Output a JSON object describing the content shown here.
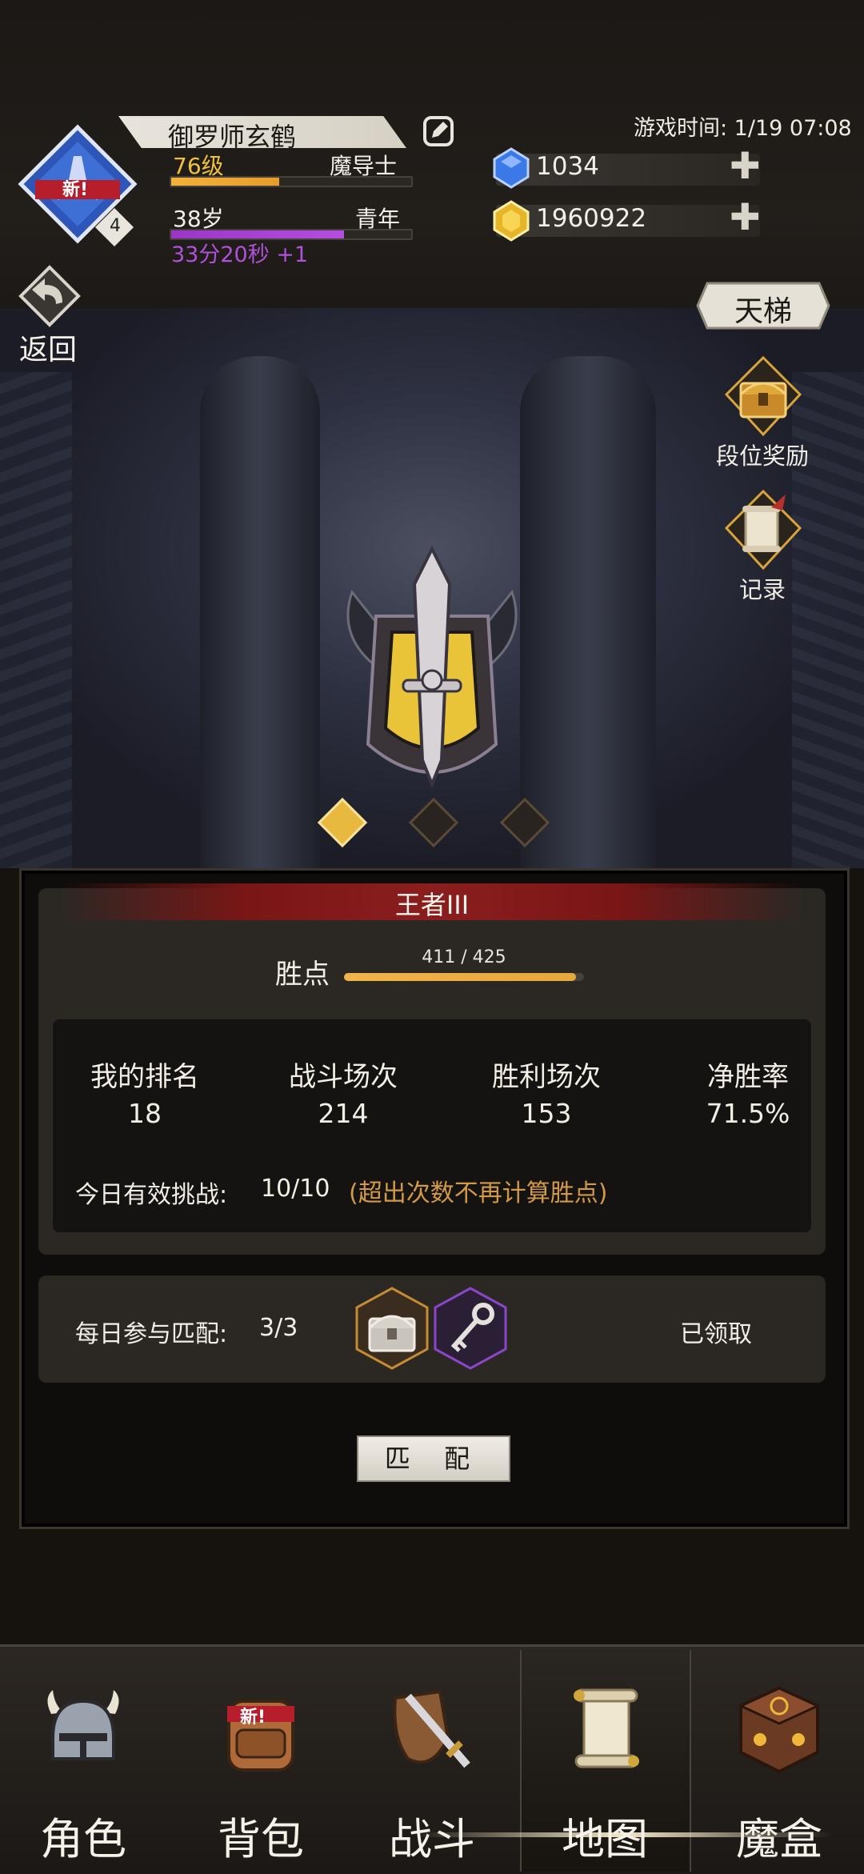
{
  "profile": {
    "name": "御罗师玄鹤",
    "level": "76级",
    "class": "魔导士",
    "age": "38岁",
    "stage": "青年",
    "timer": "33分20秒 +1",
    "avatar_badge": "新!",
    "avatar_count": "4",
    "level_progress": 0.45,
    "age_progress": 0.72
  },
  "game_time": "游戏时间: 1/19 07:08",
  "resources": {
    "gems": "1034",
    "gold": "1960922"
  },
  "nav_top": {
    "back_label": "返回",
    "ladder_label": "天梯"
  },
  "side_buttons": {
    "rank_reward": "段位奖励",
    "record": "记录"
  },
  "rank": {
    "title": "王者III",
    "points_label": "胜点",
    "points_value": "411 / 425",
    "points_progress": 0.967,
    "tier_dots": 3,
    "active_dot": 0
  },
  "stats": [
    {
      "label": "我的排名",
      "value": "18"
    },
    {
      "label": "战斗场次",
      "value": "214"
    },
    {
      "label": "胜利场次",
      "value": "153"
    },
    {
      "label": "净胜率",
      "value": "71.5%"
    }
  ],
  "daily": {
    "challenge_label": "今日有效挑战:",
    "challenge_value": "10/10",
    "challenge_note": "(超出次数不再计算胜点)",
    "match_label": "每日参与匹配:",
    "match_value": "3/3",
    "claimed": "已领取"
  },
  "match_button": "匹 配",
  "bottom_nav": [
    {
      "label": "角色",
      "icon": "helmet-icon"
    },
    {
      "label": "背包",
      "icon": "backpack-icon",
      "badge": "新!"
    },
    {
      "label": "战斗",
      "icon": "sword-shield-icon"
    },
    {
      "label": "地图",
      "icon": "scroll-map-icon",
      "active": true
    },
    {
      "label": "魔盒",
      "icon": "magic-box-icon"
    }
  ],
  "colors": {
    "accent_gold": "#e6a73c",
    "purple": "#a33fd0",
    "rank_red": "#8b1e1e"
  }
}
